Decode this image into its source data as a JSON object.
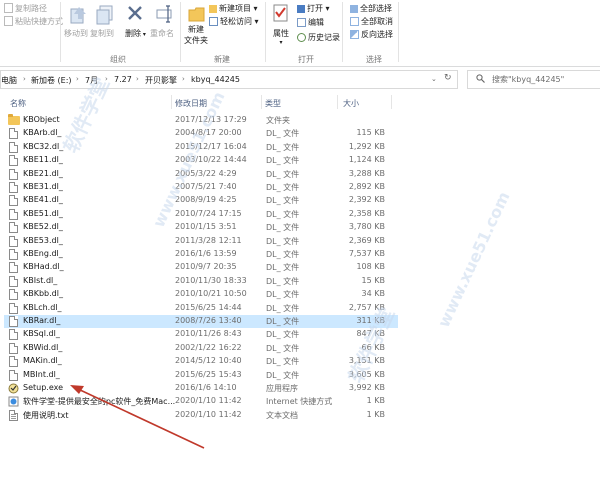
{
  "ribbon": {
    "clipboard": {
      "copy_path": "复制路径",
      "paste_shortcut": "粘贴快捷方式"
    },
    "organize": {
      "move_to": "移动到",
      "copy_to": "复制到",
      "delete": "删除",
      "rename": "重命名",
      "label": "组织"
    },
    "new": {
      "new_folder_line1": "新建",
      "new_folder_line2": "文件夹",
      "new_item": "新建项目 ▾",
      "easy_access": "轻松访问 ▾",
      "label": "新建"
    },
    "open": {
      "properties": "属性",
      "open": "打开 ▾",
      "edit": "编辑",
      "history": "历史记录",
      "label": "打开"
    },
    "select": {
      "select_all": "全部选择",
      "select_none": "全部取消",
      "invert": "反向选择",
      "label": "选择"
    }
  },
  "address": {
    "crumbs": [
      "电脑",
      "新加卷 (E:)",
      "7月",
      "7.27",
      "开贝影擎",
      "kbyq_44245"
    ],
    "search_placeholder": "搜索\"kbyq_44245\""
  },
  "columns": {
    "name": "名称",
    "date": "修改日期",
    "type": "类型",
    "size": "大小"
  },
  "files": [
    {
      "name": "KBObject",
      "date": "2017/12/13 17:29",
      "type": "文件夹",
      "size": "",
      "kind": "folder"
    },
    {
      "name": "KBArb.dl_",
      "date": "2004/8/17 20:00",
      "type": "DL_ 文件",
      "size": "115 KB",
      "kind": "file"
    },
    {
      "name": "KBC32.dl_",
      "date": "2015/12/17 16:04",
      "type": "DL_ 文件",
      "size": "1,292 KB",
      "kind": "file"
    },
    {
      "name": "KBE11.dl_",
      "date": "2003/10/22 14:44",
      "type": "DL_ 文件",
      "size": "1,124 KB",
      "kind": "file"
    },
    {
      "name": "KBE21.dl_",
      "date": "2005/3/22 4:29",
      "type": "DL_ 文件",
      "size": "3,288 KB",
      "kind": "file"
    },
    {
      "name": "KBE31.dl_",
      "date": "2007/5/21 7:40",
      "type": "DL_ 文件",
      "size": "2,892 KB",
      "kind": "file"
    },
    {
      "name": "KBE41.dl_",
      "date": "2008/9/19 4:25",
      "type": "DL_ 文件",
      "size": "2,392 KB",
      "kind": "file"
    },
    {
      "name": "KBE51.dl_",
      "date": "2010/7/24 17:15",
      "type": "DL_ 文件",
      "size": "2,358 KB",
      "kind": "file"
    },
    {
      "name": "KBE52.dl_",
      "date": "2010/1/15 3:51",
      "type": "DL_ 文件",
      "size": "3,780 KB",
      "kind": "file"
    },
    {
      "name": "KBE53.dl_",
      "date": "2011/3/28 12:11",
      "type": "DL_ 文件",
      "size": "2,369 KB",
      "kind": "file"
    },
    {
      "name": "KBEng.dl_",
      "date": "2016/1/6 13:59",
      "type": "DL_ 文件",
      "size": "7,537 KB",
      "kind": "file"
    },
    {
      "name": "KBHad.dl_",
      "date": "2010/9/7 20:35",
      "type": "DL_ 文件",
      "size": "108 KB",
      "kind": "file"
    },
    {
      "name": "KBIst.dl_",
      "date": "2010/11/30 18:33",
      "type": "DL_ 文件",
      "size": "15 KB",
      "kind": "file"
    },
    {
      "name": "KBKbb.dl_",
      "date": "2010/10/21 10:50",
      "type": "DL_ 文件",
      "size": "34 KB",
      "kind": "file"
    },
    {
      "name": "KBLch.dl_",
      "date": "2015/6/25 14:44",
      "type": "DL_ 文件",
      "size": "2,757 KB",
      "kind": "file"
    },
    {
      "name": "KBRar.dl_",
      "date": "2008/7/26 13:40",
      "type": "DL_ 文件",
      "size": "311 KB",
      "kind": "file",
      "selected": true
    },
    {
      "name": "KBSql.dl_",
      "date": "2010/11/26 8:43",
      "type": "DL_ 文件",
      "size": "847 KB",
      "kind": "file"
    },
    {
      "name": "KBWid.dl_",
      "date": "2002/1/22 16:22",
      "type": "DL_ 文件",
      "size": "66 KB",
      "kind": "file"
    },
    {
      "name": "MAKin.dl_",
      "date": "2014/5/12 10:40",
      "type": "DL_ 文件",
      "size": "3,151 KB",
      "kind": "file"
    },
    {
      "name": "MBInt.dl_",
      "date": "2015/6/25 15:43",
      "type": "DL_ 文件",
      "size": "3,605 KB",
      "kind": "file"
    },
    {
      "name": "Setup.exe",
      "date": "2016/1/6 14:10",
      "type": "应用程序",
      "size": "3,992 KB",
      "kind": "exe"
    },
    {
      "name": "软件学堂-提供最安全的pc软件_免费Mac...",
      "date": "2020/1/10 11:42",
      "type": "Internet 快捷方式",
      "size": "1 KB",
      "kind": "url"
    },
    {
      "name": "使用说明.txt",
      "date": "2020/1/10 11:42",
      "type": "文本文档",
      "size": "1 KB",
      "kind": "txt"
    }
  ],
  "watermarks": [
    "软件学堂",
    "www.xue51.com",
    "软件学堂",
    "www.xue51.com"
  ],
  "colors": {
    "selection": "#cce8ff",
    "accent": "#c0392b",
    "folder": "#f3c65a"
  }
}
